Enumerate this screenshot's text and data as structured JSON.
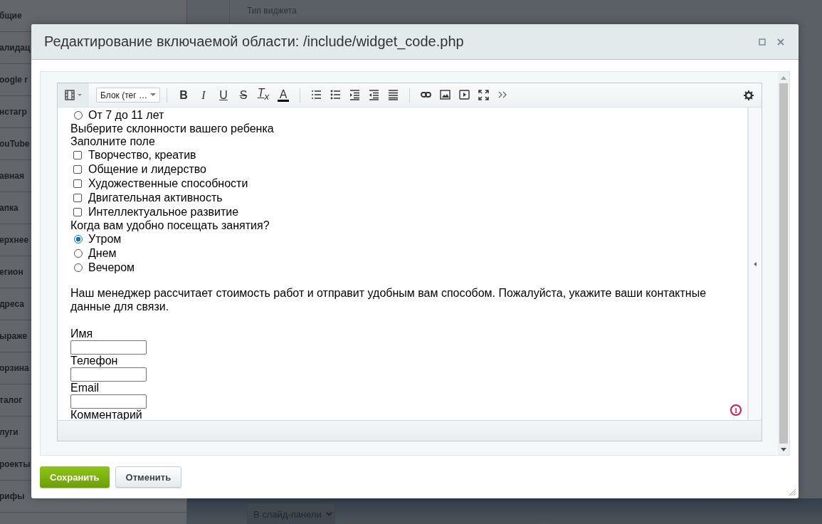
{
  "background": {
    "sidebar_items": [
      "бщие",
      "алидац",
      "oogle r",
      "нстагр",
      "ouTube",
      "авная",
      "апка",
      "ерхнее",
      "егион",
      "дреса",
      "ыраже",
      "орзина",
      "талог",
      "луги",
      "роекты",
      "рифы"
    ],
    "field_label": "Тип виджета",
    "dropdown": "В слайд-панели"
  },
  "dialog": {
    "title": "Редактирование включаемой области: /include/widget_code.php",
    "toolbar": {
      "block_select": "Блок (тег …",
      "format_buttons": [
        {
          "kind": "bold",
          "label": "B"
        },
        {
          "kind": "italic",
          "label": "I"
        },
        {
          "kind": "underline",
          "label": "U"
        },
        {
          "kind": "strike",
          "label": "S"
        },
        {
          "kind": "clear",
          "label": "T$_{x}$"
        },
        {
          "kind": "color",
          "label": "A"
        }
      ]
    },
    "content": [
      {
        "kind": "radio",
        "label": "От 7 до 11 лет",
        "selected": false
      },
      {
        "kind": "text",
        "label": "Выберите склонности вашего ребенка"
      },
      {
        "kind": "text",
        "label": "Заполните поле"
      },
      {
        "kind": "checkbox",
        "label": "Творчество, креатив",
        "checked": false
      },
      {
        "kind": "checkbox",
        "label": "Общение и лидерство",
        "checked": false
      },
      {
        "kind": "checkbox",
        "label": "Художественные способности",
        "checked": false
      },
      {
        "kind": "checkbox",
        "label": "Двигательная активность",
        "checked": false
      },
      {
        "kind": "checkbox",
        "label": "Интеллектуальное развитие",
        "checked": false
      },
      {
        "kind": "text",
        "label": "Когда вам удобно посещать занятия?"
      },
      {
        "kind": "radio",
        "label": "Утром",
        "selected": true
      },
      {
        "kind": "radio",
        "label": "Днем",
        "selected": false
      },
      {
        "kind": "radio",
        "label": "Вечером",
        "selected": false
      },
      {
        "kind": "paragraph",
        "label": "Наш менеджер рассчитает стоимость работ и отправит удобным вам способом. Пожалуйста, укажите ваши контактные данные для связи."
      },
      {
        "kind": "text",
        "label": "Имя"
      },
      {
        "kind": "input"
      },
      {
        "kind": "text",
        "label": "Телефон"
      },
      {
        "kind": "input"
      },
      {
        "kind": "text",
        "label": "Email"
      },
      {
        "kind": "input"
      },
      {
        "kind": "text",
        "label": "Комментарий"
      }
    ],
    "badge": "1",
    "buttons": [
      {
        "kind": "primary",
        "label": "Сохранить"
      },
      {
        "kind": "secondary",
        "label": "Отменить"
      }
    ]
  }
}
